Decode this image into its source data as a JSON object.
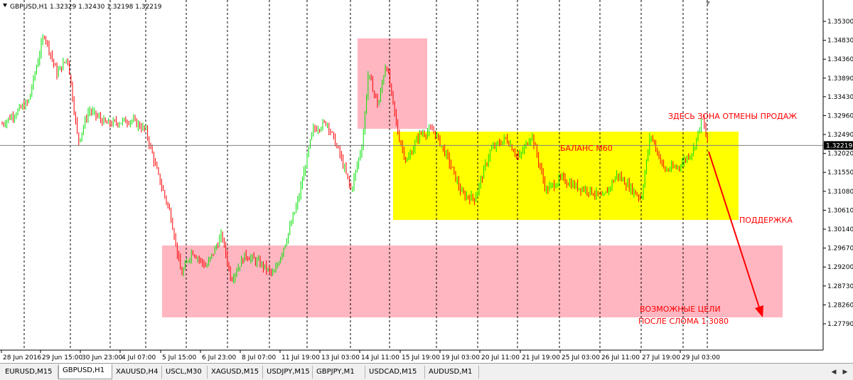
{
  "chart": {
    "header": "GBPUSD,H1  1.32329 1.32430 1.32198 1.32219",
    "current_price": "1.32219",
    "price_axis": [
      "1.35300",
      "1.34830",
      "1.34360",
      "1.33890",
      "1.33430",
      "1.32960",
      "1.32490",
      "1.32020",
      "1.31550",
      "1.31080",
      "1.30610",
      "1.30140",
      "1.29670",
      "1.29200",
      "1.28730",
      "1.28260",
      "1.27790"
    ],
    "time_axis": [
      "28 Jun 2016",
      "29 Jun 15:00",
      "30 Jun 23:00",
      "4 Jul 07:00",
      "5 Jul 15:00",
      "6 Jul 23:00",
      "8 Jul 07:00",
      "11 Jul 19:00",
      "13 Jul 03:00",
      "14 Jul 11:00",
      "15 Jul 19:00",
      "19 Jul 03:00",
      "20 Jul 11:00",
      "21 Jul 19:00",
      "25 Jul 03:00",
      "26 Jul 11:00",
      "27 Jul 19:00",
      "29 Jul 03:00"
    ],
    "annotations": {
      "cancel_zone": "ЗДЕСЬ ЗОНА ОТМЕНЫ ПРОДАЖ",
      "balance": "БАЛАНС М60",
      "support": "ПОДДЕРЖКА",
      "targets_line1": "ВОЗМОЖНЫЕ ЦЕЛИ",
      "targets_line2": "ПОСЛЕ СЛОМА 1.3080"
    },
    "colors": {
      "bull": "#00e000",
      "bear": "#ff0000",
      "pink_zone": "#ffb6c1",
      "yellow_zone": "#ffff00",
      "arrow": "#ff0000"
    }
  },
  "tabs": [
    "EURUSD,M15",
    "GBPUSD,H1",
    "XAUUSD,H4",
    "USCL,M30",
    "XAGUSD,M15",
    "USDJPY,M15",
    "GBPJPY,M1",
    "USDCAD,M15",
    "AUDUSD,M1"
  ],
  "active_tab": "GBPUSD,H1",
  "nav": {
    "left_icon": "arrow-left-icon",
    "right_icon": "arrow-right-icon"
  }
}
